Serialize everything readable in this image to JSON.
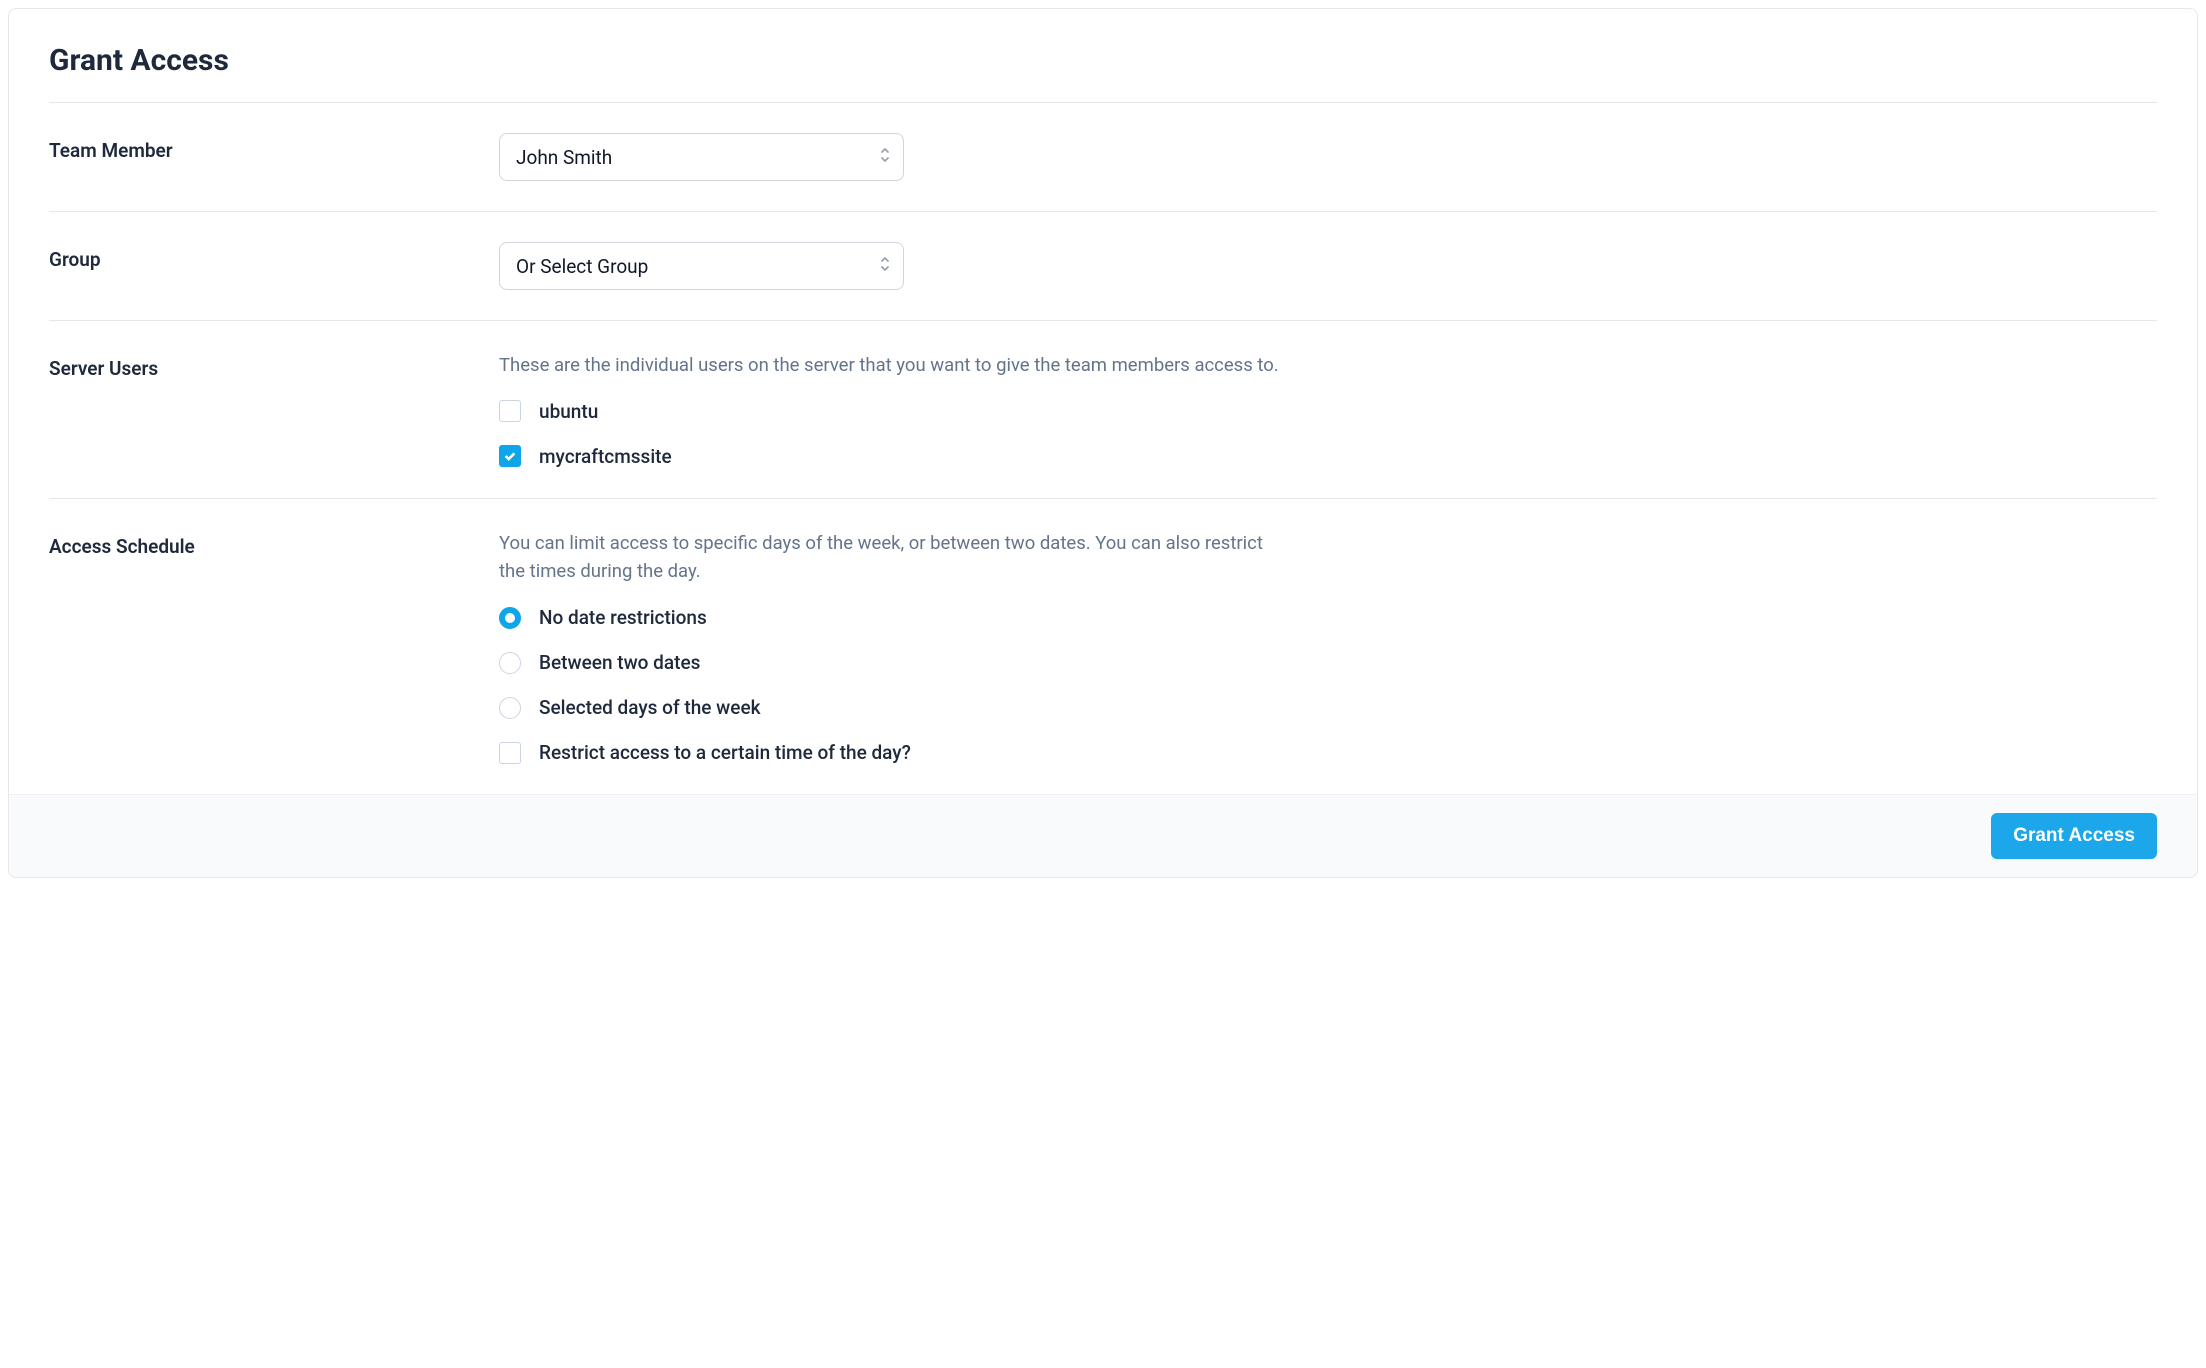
{
  "title": "Grant Access",
  "teamMember": {
    "label": "Team Member",
    "selected": "John Smith"
  },
  "group": {
    "label": "Group",
    "selected": "Or Select Group"
  },
  "serverUsers": {
    "label": "Server Users",
    "help": "These are the individual users on the server that you want to give the team members access to.",
    "options": [
      {
        "label": "ubuntu",
        "checked": false
      },
      {
        "label": "mycraftcmssite",
        "checked": true
      }
    ]
  },
  "accessSchedule": {
    "label": "Access Schedule",
    "help": "You can limit access to specific days of the week, or between two dates. You can also restrict the times during the day.",
    "radios": [
      {
        "label": "No date restrictions",
        "selected": true
      },
      {
        "label": "Between two dates",
        "selected": false
      },
      {
        "label": "Selected days of the week",
        "selected": false
      }
    ],
    "restrictTime": {
      "label": "Restrict access to a certain time of the day?",
      "checked": false
    }
  },
  "submitLabel": "Grant Access"
}
